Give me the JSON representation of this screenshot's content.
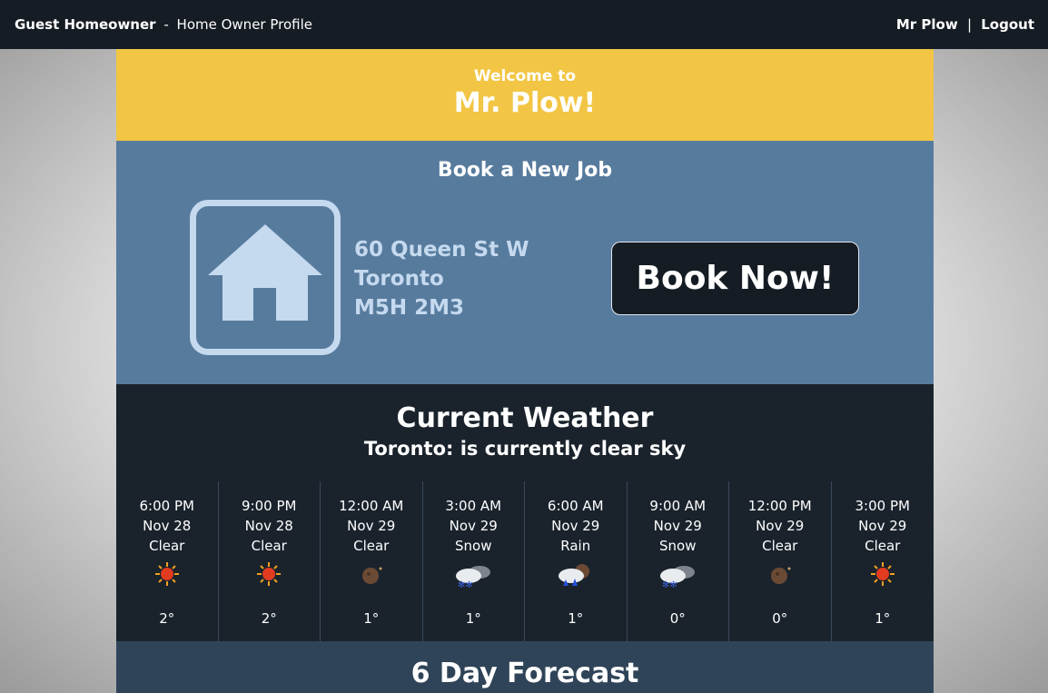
{
  "topbar": {
    "role": "Guest Homeowner",
    "separator": "-",
    "page": "Home Owner Profile",
    "user": "Mr Plow",
    "divider": "|",
    "logout": "Logout"
  },
  "welcome": {
    "line1": "Welcome to",
    "line2": "Mr. Plow!"
  },
  "book": {
    "title": "Book a New Job",
    "address_line1": "60 Queen St W",
    "address_line2": "Toronto",
    "address_line3": "M5H 2M3",
    "button": "Book Now!"
  },
  "weather": {
    "title": "Current Weather",
    "subtitle": "Toronto: is currently clear sky",
    "hours": [
      {
        "time": "6:00 PM",
        "date": "Nov 28",
        "cond": "Clear",
        "icon": "sun-icon",
        "temp": "2°"
      },
      {
        "time": "9:00 PM",
        "date": "Nov 28",
        "cond": "Clear",
        "icon": "sun-icon",
        "temp": "2°"
      },
      {
        "time": "12:00 AM",
        "date": "Nov 29",
        "cond": "Clear",
        "icon": "moon-icon",
        "temp": "1°"
      },
      {
        "time": "3:00 AM",
        "date": "Nov 29",
        "cond": "Snow",
        "icon": "snow-icon",
        "temp": "1°"
      },
      {
        "time": "6:00 AM",
        "date": "Nov 29",
        "cond": "Rain",
        "icon": "rain-icon",
        "temp": "1°"
      },
      {
        "time": "9:00 AM",
        "date": "Nov 29",
        "cond": "Snow",
        "icon": "snow-icon",
        "temp": "0°"
      },
      {
        "time": "12:00 PM",
        "date": "Nov 29",
        "cond": "Clear",
        "icon": "moon-icon",
        "temp": "0°"
      },
      {
        "time": "3:00 PM",
        "date": "Nov 29",
        "cond": "Clear",
        "icon": "sun-icon",
        "temp": "1°"
      }
    ]
  },
  "forecast": {
    "title": "6 Day Forecast"
  },
  "colors": {
    "topbar": "#151c24",
    "welcome": "#f2c544",
    "book": "#577b9d",
    "house": "#c5d9ef",
    "weather": "#1a232c",
    "forecast": "#2f4458"
  }
}
